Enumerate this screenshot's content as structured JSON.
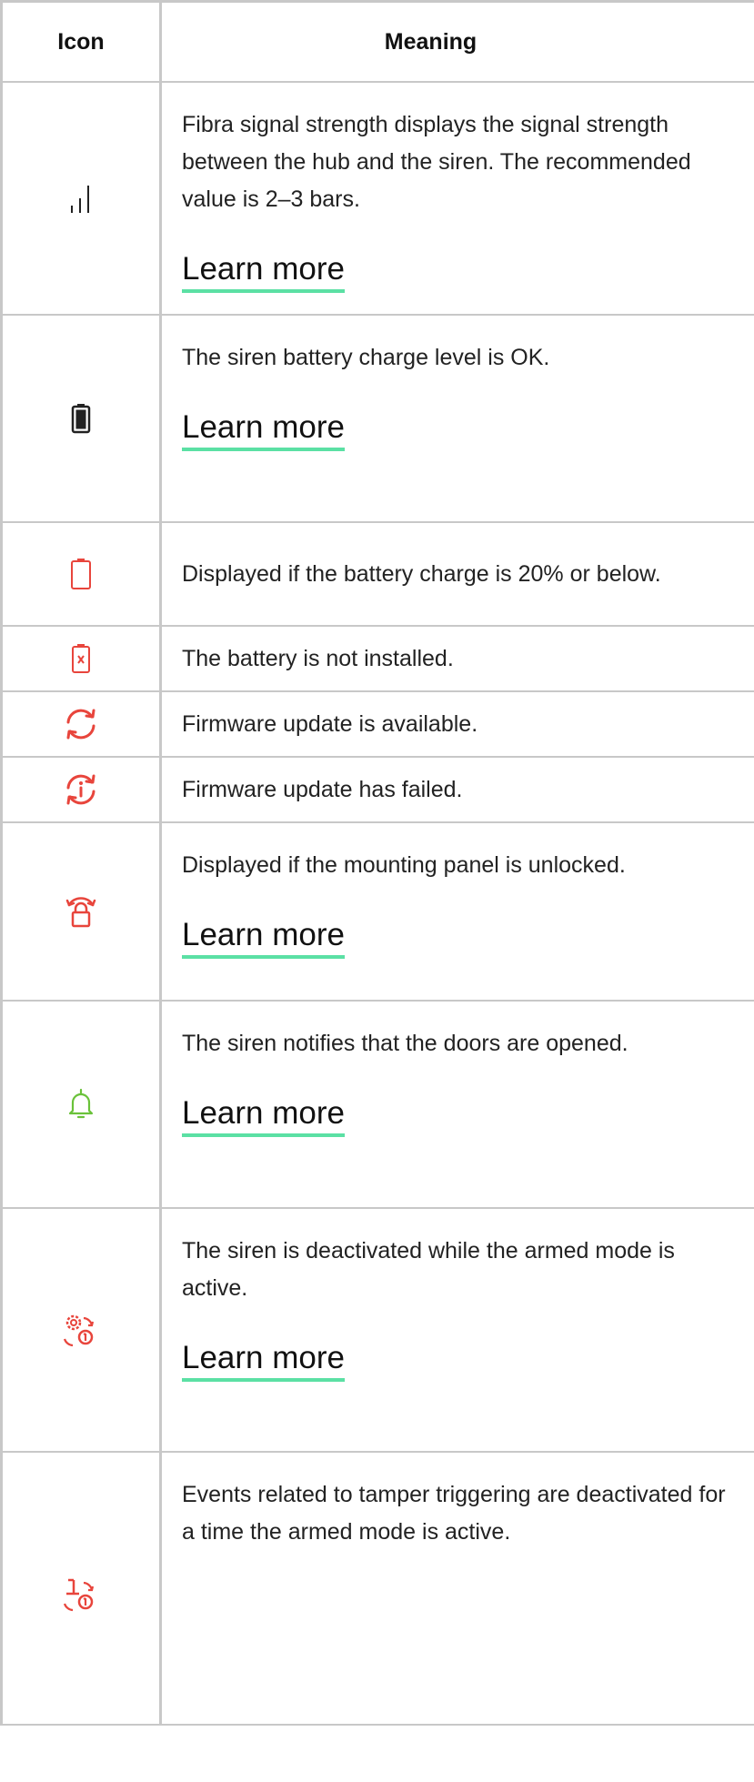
{
  "table": {
    "header": {
      "icon": "Icon",
      "meaning": "Meaning"
    },
    "rows": [
      {
        "icon": "signal-bars-icon",
        "text": "Fibra signal strength displays the signal strength between the hub and the siren. The recommended value is 2–3 bars.",
        "link": "Learn more"
      },
      {
        "icon": "battery-full-icon",
        "text": "The siren battery charge level is OK.",
        "link": "Learn more"
      },
      {
        "icon": "battery-low-icon",
        "text": "Displayed if the battery charge is 20% or below."
      },
      {
        "icon": "battery-missing-icon",
        "text": "The battery is not installed."
      },
      {
        "icon": "firmware-update-icon",
        "text": "Firmware update is available."
      },
      {
        "icon": "firmware-update-failed-icon",
        "text": "Firmware update has failed."
      },
      {
        "icon": "unlocked-panel-icon",
        "text": "Displayed if the mounting panel is unlocked.",
        "link": "Learn more"
      },
      {
        "icon": "bell-icon",
        "text": "The siren notifies that the doors are opened.",
        "link": "Learn more"
      },
      {
        "icon": "siren-deactivated-armed-icon",
        "text": "The siren is deactivated while the armed mode is active.",
        "link": "Learn more"
      },
      {
        "icon": "tamper-deactivated-armed-icon",
        "text": "Events related to tamper triggering are deactivated for a time the armed mode is active."
      }
    ]
  },
  "colors": {
    "border": "#c8c8c8",
    "link_underline": "#5be0a4",
    "icon_red": "#e8453c",
    "icon_green": "#6ac23a",
    "icon_dark": "#222222"
  }
}
